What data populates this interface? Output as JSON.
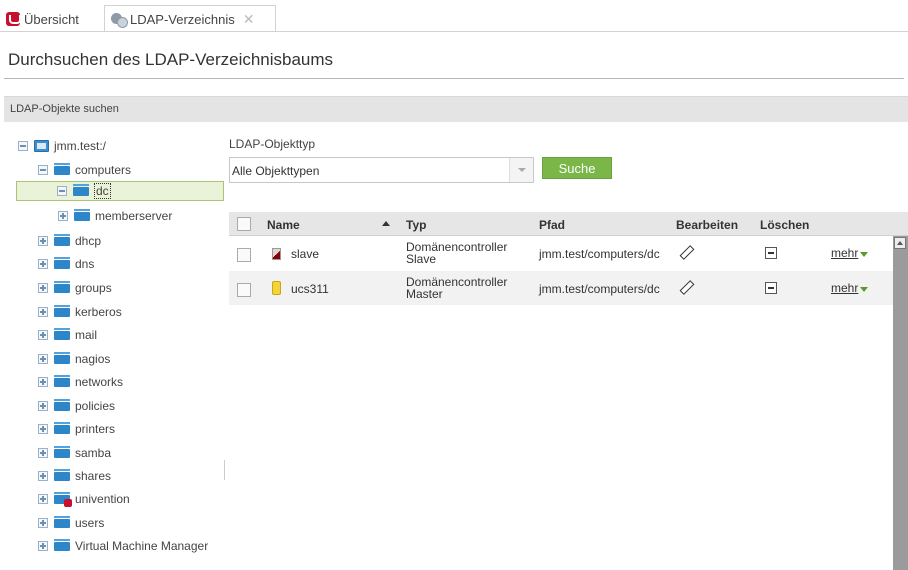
{
  "tabs": {
    "overview": "Übersicht",
    "ldap": "LDAP-Verzeichnis",
    "close_symbol": "✕"
  },
  "page": {
    "title": "Durchsuchen des LDAP-Verzeichnisbaums",
    "section": "LDAP-Objekte suchen"
  },
  "tree": {
    "root": "jmm.test:/",
    "computers": "computers",
    "dc": "dc",
    "memberserver": "memberserver",
    "items": [
      "dhcp",
      "dns",
      "groups",
      "kerberos",
      "mail",
      "nagios",
      "networks",
      "policies",
      "printers",
      "samba",
      "shares",
      "univention",
      "users",
      "Virtual Machine Manager"
    ]
  },
  "search": {
    "type_label": "LDAP-Objekttyp",
    "type_value": "Alle Objekttypen",
    "button": "Suche"
  },
  "grid": {
    "columns": {
      "name": "Name",
      "typ": "Typ",
      "pfad": "Pfad",
      "bearbeiten": "Bearbeiten",
      "loeschen": "Löschen"
    },
    "rows": [
      {
        "name": "slave",
        "typ1": "Domänencontroller",
        "typ2": "Slave",
        "pfad": "jmm.test/computers/dc",
        "mehr": "mehr"
      },
      {
        "name": "ucs311",
        "typ1": "Domänencontroller",
        "typ2": "Master",
        "pfad": "jmm.test/computers/dc",
        "mehr": "mehr"
      }
    ]
  },
  "colors": {
    "accent_green": "#7ab648",
    "folder_blue": "#2d86c8",
    "brand_red": "#c8102e"
  }
}
